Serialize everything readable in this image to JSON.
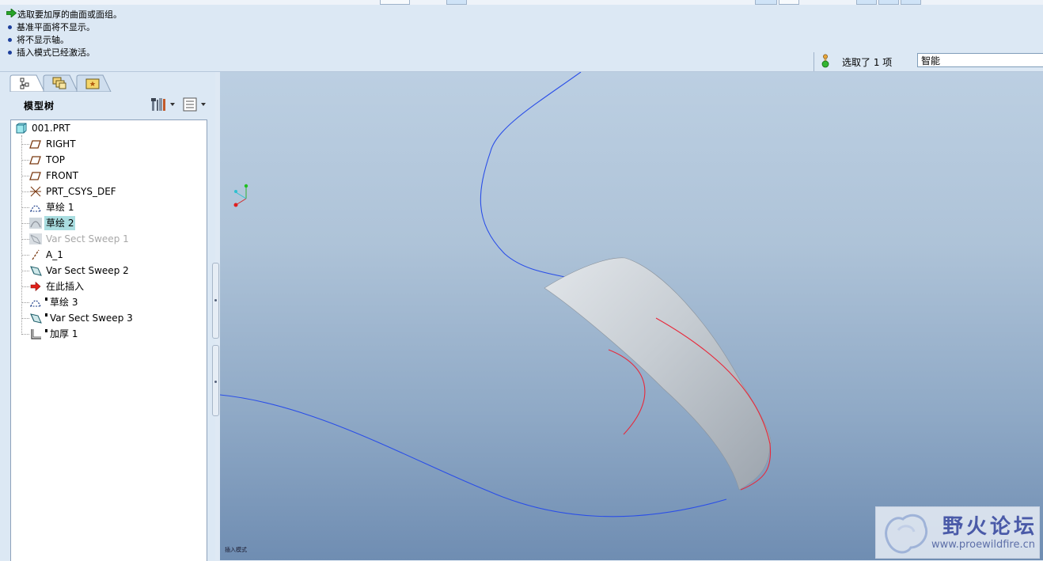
{
  "messages": {
    "lines": [
      "选取要加厚的曲面或面组。",
      "基准平面将不显示。",
      "将不显示轴。",
      "插入模式已经激活。"
    ]
  },
  "selection": {
    "count_text": "选取了 1 项",
    "filter_value": "智能"
  },
  "model_tree": {
    "title": "模型树",
    "tabs": [
      "model-tree-icon",
      "layers-icon",
      "favorites-icon"
    ],
    "root": "001.PRT",
    "items": [
      {
        "label": "RIGHT",
        "icon": "datum-plane-icon"
      },
      {
        "label": "TOP",
        "icon": "datum-plane-icon"
      },
      {
        "label": "FRONT",
        "icon": "datum-plane-icon"
      },
      {
        "label": "PRT_CSYS_DEF",
        "icon": "csys-icon"
      },
      {
        "label": "草绘 1",
        "icon": "sketch-icon"
      },
      {
        "label": "草绘 2",
        "icon": "sketch-icon",
        "selected": true
      },
      {
        "label": "Var Sect Sweep 1",
        "icon": "sweep-icon",
        "suppressed": true
      },
      {
        "label": "A_1",
        "icon": "datum-axis-icon"
      },
      {
        "label": "Var Sect Sweep 2",
        "icon": "sweep-icon"
      },
      {
        "label": "在此插入",
        "icon": "insert-here-icon"
      },
      {
        "label": "草绘 3",
        "icon": "sketch-icon"
      },
      {
        "label": "Var Sect Sweep 3",
        "icon": "sweep-icon"
      },
      {
        "label": "加厚 1",
        "icon": "thicken-icon"
      }
    ]
  },
  "viewport": {
    "status_hint": "插入模式",
    "watermark_title": "野火论坛",
    "watermark_url": "www.proewildfire.cn"
  },
  "colors": {
    "curve_blue": "#2a4ee8",
    "curve_red": "#e8283a",
    "surface_gray": "#c9d0d6",
    "selection_highlight": "#a9dde0"
  }
}
